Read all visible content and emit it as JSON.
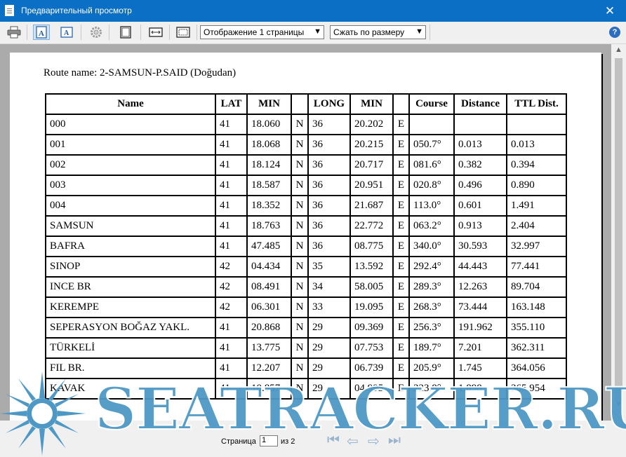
{
  "window": {
    "title": "Предварительный просмотр",
    "close_glyph": "✕"
  },
  "toolbar": {
    "view_select": "Отображение 1 страницы",
    "fit_select": "Сжать по размеру",
    "help_glyph": "?",
    "icons": [
      "printer-icon",
      "page-width-icon",
      "text-icon",
      "settings-icon",
      "single-page-icon",
      "fit-width-icon",
      "zoom-page-icon",
      "help-icon"
    ]
  },
  "document": {
    "route_name": "Route name: 2-SAMSUN-P.SAID (Doğudan)",
    "headers": [
      "Name",
      "LAT",
      "MIN",
      "",
      "LONG",
      "MIN",
      "",
      "Course",
      "Distance",
      "TTL Dist."
    ],
    "rows": [
      [
        "000",
        "41",
        "18.060",
        "N",
        "36",
        "20.202",
        "E",
        "",
        "",
        ""
      ],
      [
        "001",
        "41",
        "18.068",
        "N",
        "36",
        "20.215",
        "E",
        "050.7°",
        "0.013",
        "0.013"
      ],
      [
        "002",
        "41",
        "18.124",
        "N",
        "36",
        "20.717",
        "E",
        "081.6°",
        "0.382",
        "0.394"
      ],
      [
        "003",
        "41",
        "18.587",
        "N",
        "36",
        "20.951",
        "E",
        "020.8°",
        "0.496",
        "0.890"
      ],
      [
        "004",
        "41",
        "18.352",
        "N",
        "36",
        "21.687",
        "E",
        "113.0°",
        "0.601",
        "1.491"
      ],
      [
        "SAMSUN",
        "41",
        "18.763",
        "N",
        "36",
        "22.772",
        "E",
        "063.2°",
        "0.913",
        "2.404"
      ],
      [
        "BAFRA",
        "41",
        "47.485",
        "N",
        "36",
        "08.775",
        "E",
        "340.0°",
        "30.593",
        "32.997"
      ],
      [
        "SINOP",
        "42",
        "04.434",
        "N",
        "35",
        "13.592",
        "E",
        "292.4°",
        "44.443",
        "77.441"
      ],
      [
        "INCE BR",
        "42",
        "08.491",
        "N",
        "34",
        "58.005",
        "E",
        "289.3°",
        "12.263",
        "89.704"
      ],
      [
        "KEREMPE",
        "42",
        "06.301",
        "N",
        "33",
        "19.095",
        "E",
        "268.3°",
        "73.444",
        "163.148"
      ],
      [
        "SEPERASYON BOĞAZ YAKL.",
        "41",
        "20.868",
        "N",
        "29",
        "09.369",
        "E",
        "256.3°",
        "191.962",
        "355.110"
      ],
      [
        "TÜRKELİ",
        "41",
        "13.775",
        "N",
        "29",
        "07.753",
        "E",
        "189.7°",
        "7.201",
        "362.311"
      ],
      [
        "FIL BR.",
        "41",
        "12.207",
        "N",
        "29",
        "06.739",
        "E",
        "205.9°",
        "1.745",
        "364.056"
      ],
      [
        "KAVAK",
        "41",
        "10.857",
        "N",
        "29",
        "04.995",
        "E",
        "223.8°",
        "1.898",
        "365.954"
      ]
    ]
  },
  "status": {
    "page_label": "Страница",
    "page_value": "1",
    "of_label": "из 2"
  },
  "watermark": {
    "text": "SEATRACKER.RU"
  },
  "colors": {
    "titlebar": "#0b6fc6",
    "watermark": "#4e98c6"
  }
}
